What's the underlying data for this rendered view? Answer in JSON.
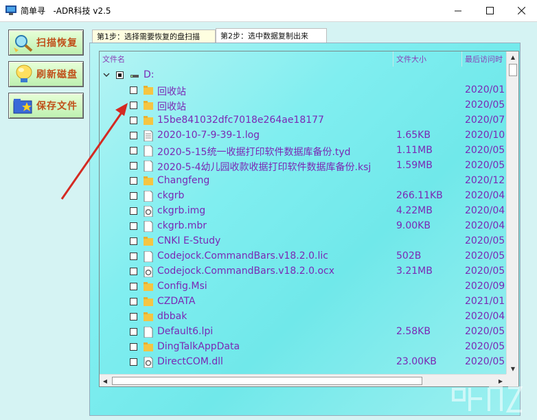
{
  "window": {
    "title": "简单寻   -ADR科技 v2.5"
  },
  "sidebar": {
    "buttons": [
      {
        "label": "扫描恢复",
        "icon": "magnifier-icon"
      },
      {
        "label": "刷新磁盘",
        "icon": "bulb-icon"
      },
      {
        "label": "保存文件",
        "icon": "folder-star-icon"
      }
    ]
  },
  "tabs": [
    {
      "label": "第1步：选择需要恢复的盘扫描",
      "active": false
    },
    {
      "label": "第2步：选中数据复制出来",
      "active": true
    }
  ],
  "table": {
    "columns": [
      "文件名",
      "文件大小",
      "最后访问时"
    ],
    "root": {
      "label": "D:",
      "checked": true
    },
    "rows": [
      {
        "name": "回收站",
        "size": "",
        "date": "2020/01",
        "type": "folder"
      },
      {
        "name": "回收站",
        "size": "",
        "date": "2020/05",
        "type": "folder"
      },
      {
        "name": "15be841032dfc7018e264ae18177",
        "size": "",
        "date": "2020/07",
        "type": "folder"
      },
      {
        "name": "2020-10-7-9-39-1.log",
        "size": "1.65KB",
        "date": "2020/10",
        "type": "textfile"
      },
      {
        "name": "2020-5-15统一收据打印软件数据库备份.tyd",
        "size": "1.11MB",
        "date": "2020/05",
        "type": "file"
      },
      {
        "name": "2020-5-4幼儿园收款收据打印软件数据库备份.ksj",
        "size": "1.59MB",
        "date": "2020/05",
        "type": "file"
      },
      {
        "name": "Changfeng",
        "size": "",
        "date": "2020/12",
        "type": "folder"
      },
      {
        "name": "ckgrb",
        "size": "266.11KB",
        "date": "2020/04",
        "type": "file"
      },
      {
        "name": "ckgrb.img",
        "size": "4.22MB",
        "date": "2020/04",
        "type": "gearfile"
      },
      {
        "name": "ckgrb.mbr",
        "size": "9.00KB",
        "date": "2020/04",
        "type": "file"
      },
      {
        "name": "CNKI E-Study",
        "size": "",
        "date": "2020/05",
        "type": "folder"
      },
      {
        "name": "Codejock.CommandBars.v18.2.0.lic",
        "size": "502B",
        "date": "2020/05",
        "type": "file"
      },
      {
        "name": "Codejock.CommandBars.v18.2.0.ocx",
        "size": "3.21MB",
        "date": "2020/05",
        "type": "gearfile"
      },
      {
        "name": "Config.Msi",
        "size": "",
        "date": "2020/09",
        "type": "folder"
      },
      {
        "name": "CZDATA",
        "size": "",
        "date": "2021/01",
        "type": "folder"
      },
      {
        "name": "dbbak",
        "size": "",
        "date": "2020/04",
        "type": "folder"
      },
      {
        "name": "Default6.lpi",
        "size": "2.58KB",
        "date": "2020/05",
        "type": "file"
      },
      {
        "name": "DingTalkAppData",
        "size": "",
        "date": "2020/05",
        "type": "folder"
      },
      {
        "name": "DirectCOM.dll",
        "size": "23.00KB",
        "date": "2020/05",
        "type": "gearfile"
      }
    ]
  },
  "colors": {
    "text_purple": "#7a28b4",
    "folder_yellow": "#f5c542",
    "sidebar_label": "#c0501a",
    "arrow_red": "#d42a22"
  }
}
